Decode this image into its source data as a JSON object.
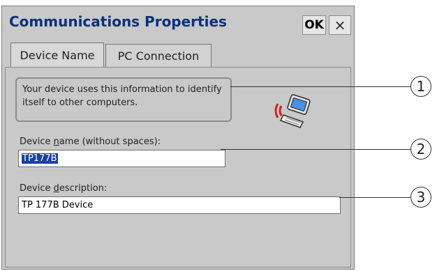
{
  "window": {
    "title": "Communications Properties",
    "ok_label": "OK",
    "close_glyph": "×"
  },
  "tabs": [
    {
      "label": "Device Name",
      "selected": true
    },
    {
      "label": "PC Connection",
      "selected": false
    }
  ],
  "info_text": "Your device uses this information to identify itself to other computers.",
  "icon": "wireless-computer-icon",
  "device_name": {
    "label_pre": "Device ",
    "label_accel": "n",
    "label_post": "ame (without spaces):",
    "value": "TP177B"
  },
  "device_description": {
    "label_pre": "Device ",
    "label_accel": "d",
    "label_post": "escription:",
    "value": "TP 177B Device"
  },
  "callouts": [
    "1",
    "2",
    "3"
  ],
  "colors": {
    "title": "#08327a",
    "selection": "#1a3fa8",
    "dialog_bg": "#c9c9c9"
  }
}
